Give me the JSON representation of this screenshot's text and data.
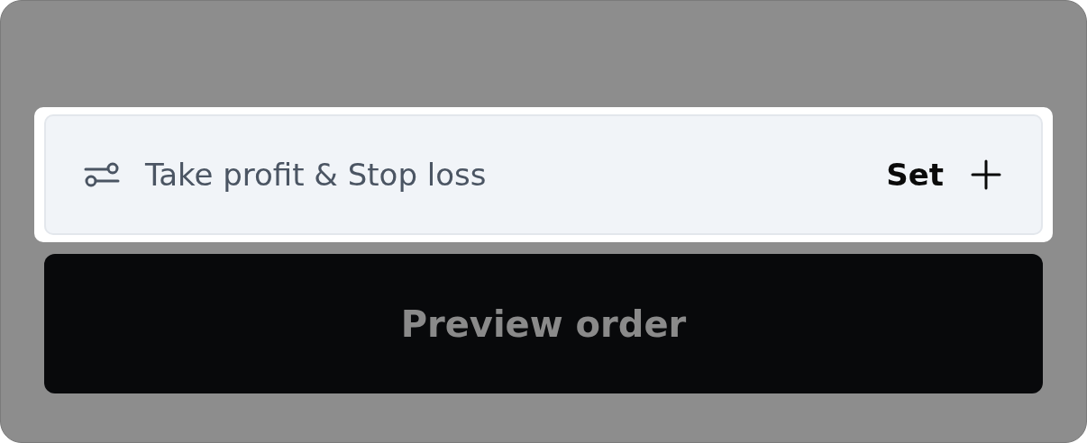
{
  "tp_sl_row": {
    "label": "Take profit & Stop loss",
    "action": "Set",
    "highlighted": true
  },
  "preview_button": {
    "label": "Preview order",
    "disabled": true
  }
}
